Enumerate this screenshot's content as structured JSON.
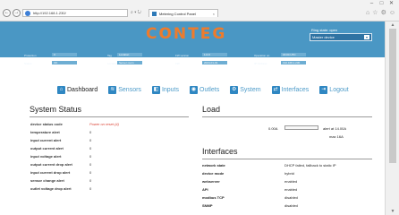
{
  "browser": {
    "url": "http://192.168.1.230/",
    "tab_title": "Metering Control Panel",
    "back_icon": "arrow-left-icon",
    "forward_icon": "arrow-right-icon"
  },
  "header": {
    "logo": "CONTEG",
    "ring_state": "Ring state: open",
    "master_select": "Master device",
    "info": [
      {
        "label": "Protection",
        "value": "3"
      },
      {
        "label": "Tag",
        "value": "Location"
      },
      {
        "label": "FW version",
        "value": "1.0.0"
      },
      {
        "label": "Operation on",
        "value": "16:04 UTC"
      },
      {
        "label": "Status",
        "value": "OK"
      },
      {
        "label": "Location",
        "value": "Server room"
      },
      {
        "label": "FW",
        "value": "2024-01-01"
      },
      {
        "label": "IP Address",
        "value": "192.168.1.230"
      }
    ]
  },
  "nav": {
    "items": [
      {
        "label": "Dashboard",
        "icon": "home-icon"
      },
      {
        "label": "Sensors",
        "icon": "sensor-icon"
      },
      {
        "label": "Inputs",
        "icon": "input-icon"
      },
      {
        "label": "Outlets",
        "icon": "outlet-icon"
      },
      {
        "label": "System",
        "icon": "gear-icon"
      },
      {
        "label": "Interfaces",
        "icon": "network-icon"
      },
      {
        "label": "Logout",
        "icon": "logout-icon"
      }
    ]
  },
  "system_status": {
    "title": "System Status",
    "rows": [
      {
        "key": "device status code",
        "value": "Power on reset (4)",
        "warn": true
      },
      {
        "key": "temperature alert",
        "value": "0"
      },
      {
        "key": "input current alert",
        "value": "0"
      },
      {
        "key": "output current alert",
        "value": "0"
      },
      {
        "key": "input voltage alert",
        "value": "0"
      },
      {
        "key": "output current drop alert",
        "value": "0"
      },
      {
        "key": "input current drop alert",
        "value": "0"
      },
      {
        "key": "sensor change alert",
        "value": "0"
      },
      {
        "key": "outlet voltage drop alert",
        "value": "0"
      }
    ]
  },
  "load": {
    "title": "Load",
    "value_label": "0.00A",
    "fill_fraction": 0.0,
    "alert": "alert at  14.00A",
    "max": "max    16A"
  },
  "interfaces": {
    "title": "Interfaces",
    "rows": [
      {
        "key": "network state",
        "value": "DHCP failed, fallback to static IP"
      },
      {
        "key": "device mode",
        "value": "hybrid"
      },
      {
        "key": "webserver",
        "value": "enabled"
      },
      {
        "key": "API",
        "value": "enabled"
      },
      {
        "key": "modbus TCP",
        "value": "disabled"
      },
      {
        "key": "SNMP",
        "value": "disabled"
      }
    ]
  },
  "colors": {
    "banner": "#4a97c4",
    "logo": "#ee7b2c",
    "nav_active": "#222222",
    "nav_link": "#4d9bc9",
    "warning": "#d93a2b"
  }
}
